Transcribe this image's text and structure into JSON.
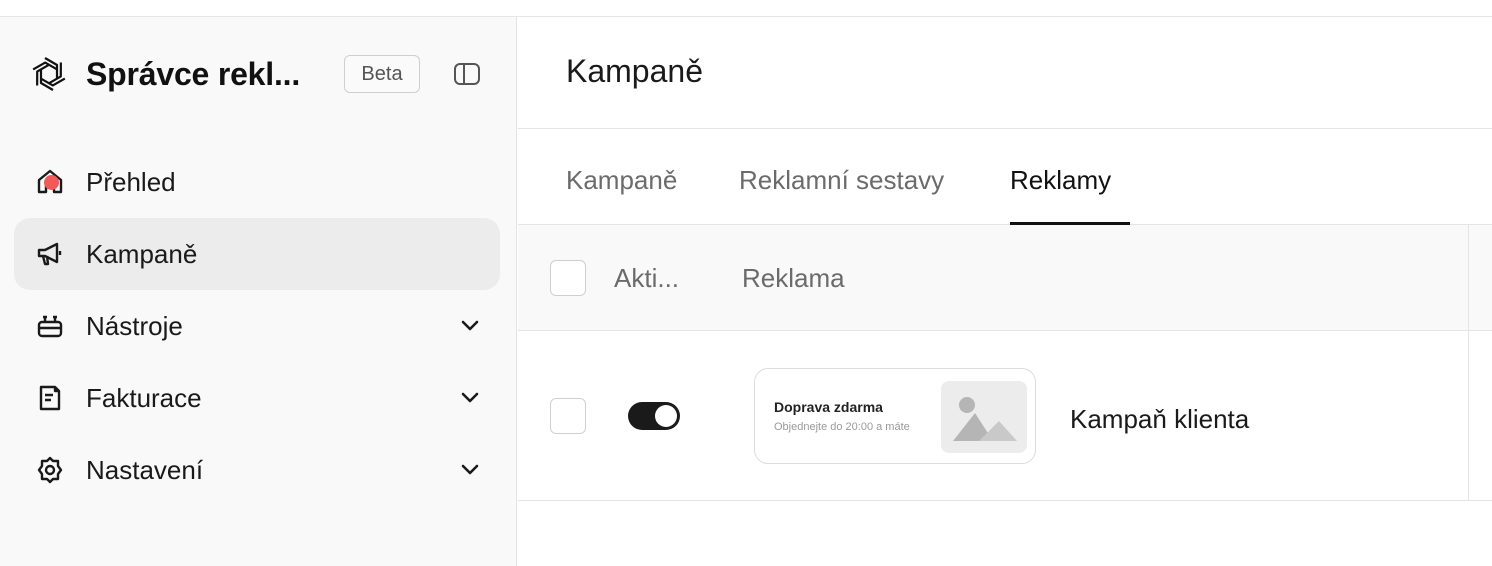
{
  "sidebar": {
    "brand": {
      "title": "Správce rekl...",
      "badge": "Beta"
    },
    "items": [
      {
        "label": "Přehled",
        "icon": "home-icon",
        "has_notification": true
      },
      {
        "label": "Kampaně",
        "icon": "megaphone-icon",
        "active": true
      },
      {
        "label": "Nástroje",
        "icon": "tools-icon",
        "expandable": true
      },
      {
        "label": "Fakturace",
        "icon": "receipt-icon",
        "expandable": true
      },
      {
        "label": "Nastavení",
        "icon": "gear-icon",
        "expandable": true
      }
    ]
  },
  "header": {
    "title": "Kampaně"
  },
  "tabs": [
    {
      "label": "Kampaně"
    },
    {
      "label": "Reklamní sestavy"
    },
    {
      "label": "Reklamy",
      "active": true
    }
  ],
  "table": {
    "columns": [
      "Akti...",
      "Reklama"
    ],
    "rows": [
      {
        "active": true,
        "preview": {
          "headline": "Doprava zdarma",
          "subtext": "Objednejte do 20:00 a máte"
        },
        "name": "Kampaň klienta"
      }
    ]
  },
  "colors": {
    "notification": "#f05a5a",
    "toggle_on": "#1a1a1a",
    "active_nav": "#ececec"
  }
}
